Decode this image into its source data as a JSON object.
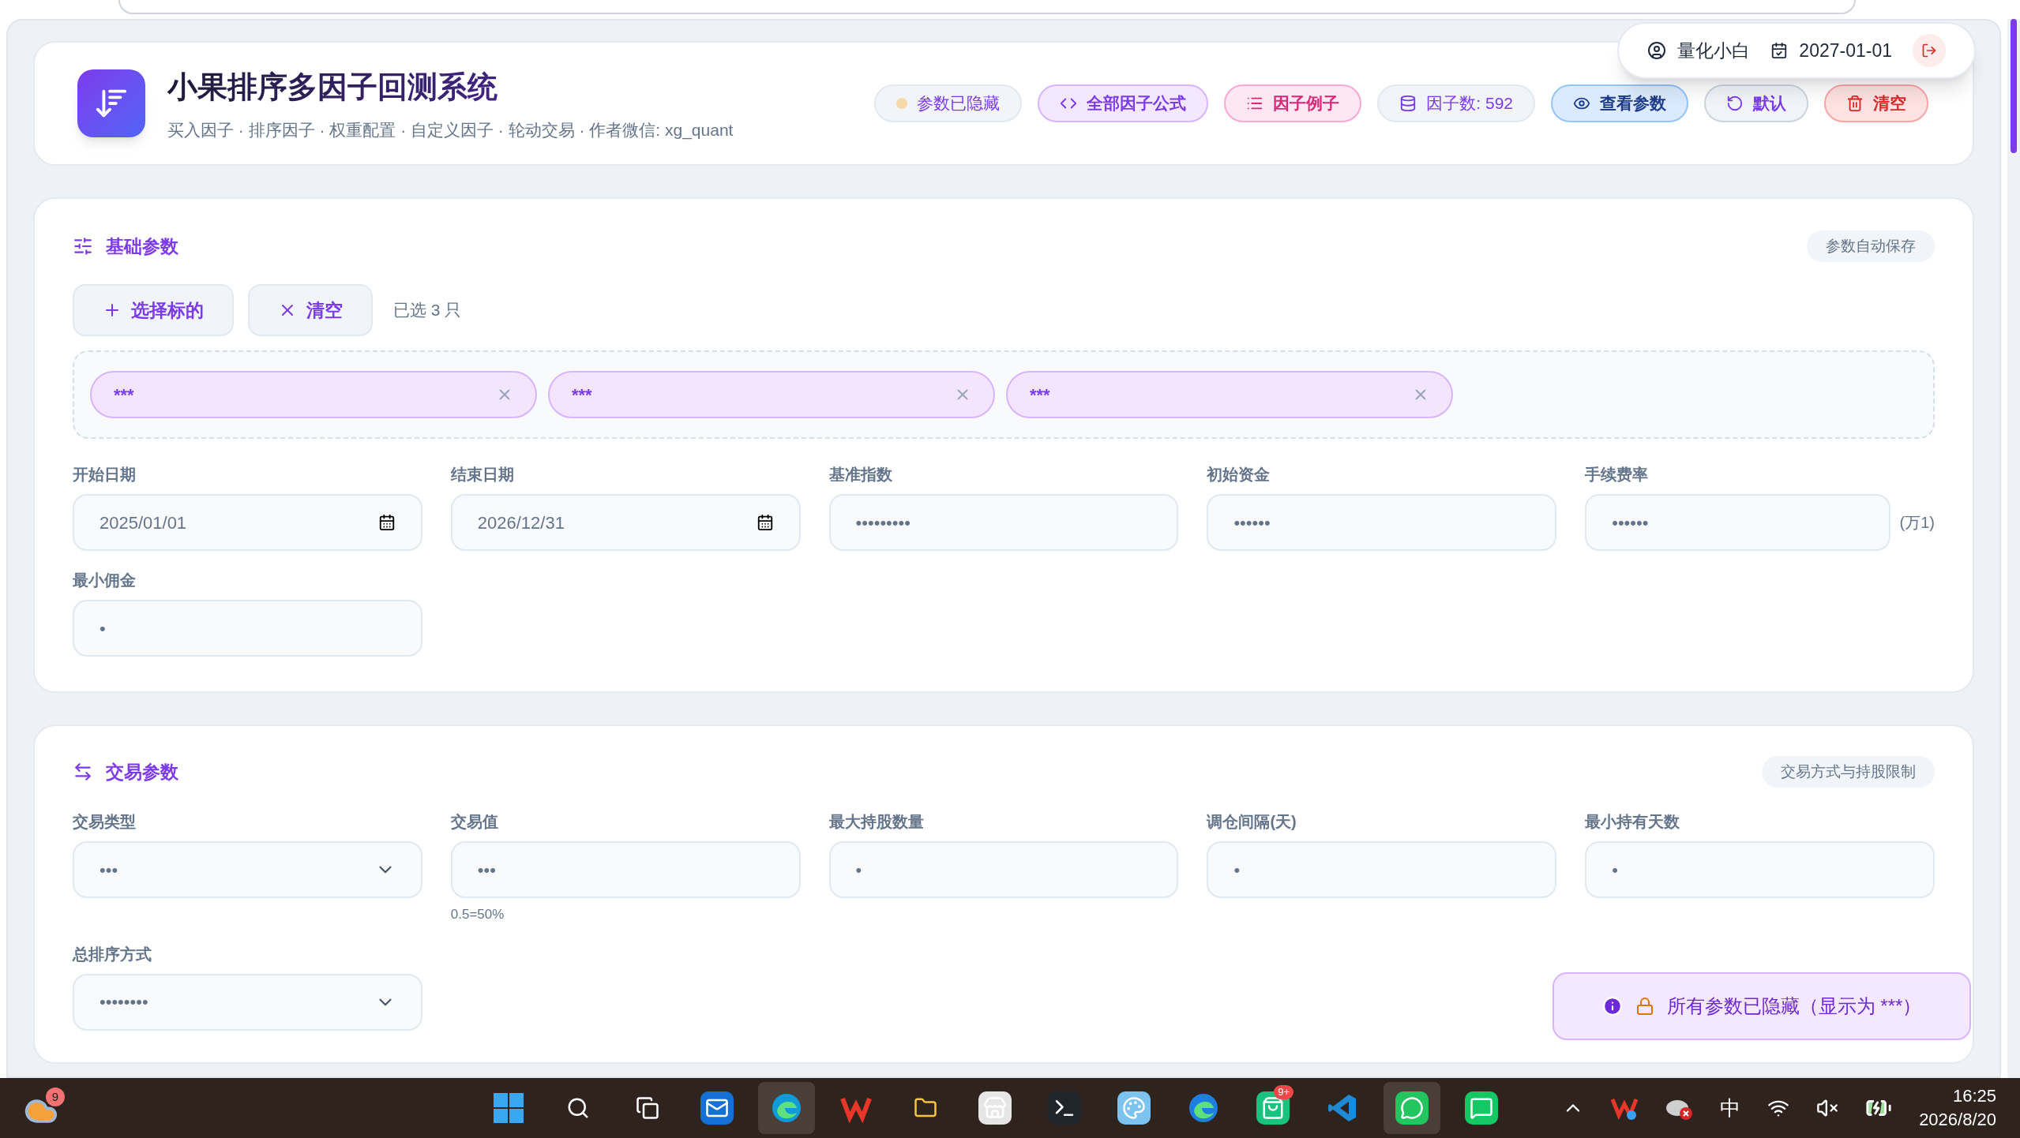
{
  "header": {
    "title": "小果排序多因子回测系统",
    "subtitle": "买入因子 · 排序因子 · 权重配置 · 自定义因子 · 轮动交易 · 作者微信: xg_quant",
    "actions": [
      {
        "kind": "status",
        "label": "参数已隐藏"
      },
      {
        "kind": "formula",
        "label": "全部因子公式"
      },
      {
        "kind": "examples",
        "label": "因子例子"
      },
      {
        "kind": "count",
        "label": "因子数: 592"
      },
      {
        "kind": "view",
        "label": "查看参数"
      },
      {
        "kind": "default",
        "label": "默认"
      },
      {
        "kind": "clear",
        "label": "清空"
      }
    ],
    "user": {
      "name": "量化小白",
      "date": "2027-01-01"
    }
  },
  "sections": [
    {
      "kind": "basic",
      "title": "基础参数",
      "tag": "参数自动保存",
      "buttons": [
        {
          "kind": "add",
          "label": "选择标的"
        },
        {
          "kind": "clear",
          "label": "清空"
        }
      ],
      "selected_count": "已选 3 只",
      "chips": [
        "***",
        "***",
        "***"
      ],
      "fields": [
        {
          "label": "开始日期",
          "kind": "date",
          "value": "2025/01/01"
        },
        {
          "label": "结束日期",
          "kind": "date",
          "value": "2026/12/31"
        },
        {
          "label": "基准指数",
          "kind": "text",
          "value": "•••••••••"
        },
        {
          "label": "初始资金",
          "kind": "text",
          "value": "••••••"
        },
        {
          "label": "手续费率",
          "kind": "text",
          "value": "••••••",
          "suffix": "(万1)"
        },
        {
          "label": "最小佣金",
          "kind": "text",
          "value": "•"
        }
      ]
    },
    {
      "kind": "trade",
      "title": "交易参数",
      "tag": "交易方式与持股限制",
      "fields": [
        {
          "label": "交易类型",
          "kind": "select",
          "value": "•••"
        },
        {
          "label": "交易值",
          "kind": "text",
          "value": "•••",
          "hint": "0.5=50%"
        },
        {
          "label": "最大持股数量",
          "kind": "text",
          "value": "•"
        },
        {
          "label": "调仓间隔(天)",
          "kind": "text",
          "value": "•"
        },
        {
          "label": "最小持有天数",
          "kind": "text",
          "value": "•"
        },
        {
          "label": "总排序方式",
          "kind": "select",
          "value": "••••••••"
        }
      ]
    }
  ],
  "toast": {
    "text": "所有参数已隐藏（显示为 ***）"
  },
  "taskbar": {
    "weather_badge": "9",
    "apps": [
      {
        "kind": "start",
        "selected": false
      },
      {
        "kind": "search",
        "selected": false
      },
      {
        "kind": "taskview",
        "selected": false
      },
      {
        "kind": "mail",
        "selected": false
      },
      {
        "kind": "browser",
        "selected": true
      },
      {
        "kind": "office",
        "selected": false
      },
      {
        "kind": "folder",
        "selected": false
      },
      {
        "kind": "store",
        "selected": false
      },
      {
        "kind": "terminal",
        "selected": false
      },
      {
        "kind": "paint",
        "selected": false
      },
      {
        "kind": "browser-ai",
        "selected": false
      },
      {
        "kind": "bag",
        "selected": false,
        "badge": "9+"
      },
      {
        "kind": "code",
        "selected": false
      },
      {
        "kind": "chat",
        "selected": true
      },
      {
        "kind": "message",
        "selected": false
      }
    ],
    "ime": "中",
    "time": "16:25",
    "date": "2026/8/20"
  }
}
